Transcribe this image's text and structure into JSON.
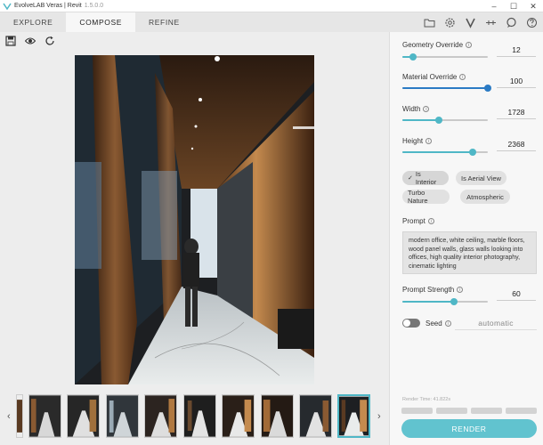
{
  "window": {
    "title": "EvolveLAB Veras | Revit",
    "version": "1.5.0.0",
    "controls": [
      "–",
      "☐",
      "✕"
    ]
  },
  "tabs": [
    {
      "label": "EXPLORE",
      "active": false
    },
    {
      "label": "COMPOSE",
      "active": true
    },
    {
      "label": "REFINE",
      "active": false
    }
  ],
  "toolbar_icons": [
    "folder-icon",
    "settings-icon",
    "veras-logo-icon",
    "network-icon",
    "chat-icon",
    "help-icon"
  ],
  "mini_tools": [
    "save-icon",
    "eye-icon",
    "refresh-icon"
  ],
  "controls": {
    "geometry_override": {
      "label": "Geometry Override",
      "value": "12",
      "fraction": 0.12
    },
    "material_override": {
      "label": "Material Override",
      "value": "100",
      "fraction": 1.0
    },
    "width": {
      "label": "Width",
      "value": "1728",
      "fraction": 0.43
    },
    "height": {
      "label": "Height",
      "value": "2368",
      "fraction": 0.82
    },
    "prompt_strength": {
      "label": "Prompt Strength",
      "value": "60",
      "fraction": 0.6
    }
  },
  "chips": [
    {
      "label": "Is Interior",
      "checked": true
    },
    {
      "label": "Is Aerial View",
      "checked": false
    },
    {
      "label": "Turbo Nature",
      "checked": false
    },
    {
      "label": "Atmospheric",
      "checked": false
    }
  ],
  "prompt": {
    "label": "Prompt",
    "text": "modern office, white ceiling, marble floors, wood panel walls, glass walls looking into offices, high quality interior photography, cinematic lighting"
  },
  "seed": {
    "label": "Seed",
    "value": "automatic",
    "enabled": false
  },
  "render_time": "Render Time: 41.822s",
  "render_button": "RENDER",
  "thumbnails": {
    "count": 9,
    "selected_index": 8
  },
  "nav": {
    "prev": "‹",
    "next": "›"
  },
  "colors": {
    "accent": "#4fb7c6",
    "slider_blue": "#2b7bc4",
    "render_button": "#61c3cf"
  }
}
